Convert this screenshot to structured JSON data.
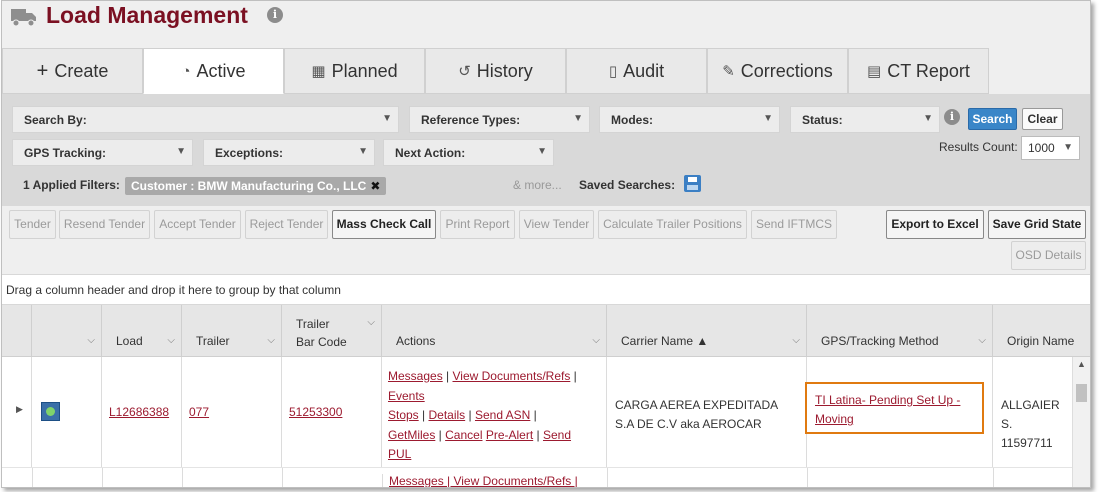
{
  "header": {
    "title": "Load Management",
    "info_icon": "info-icon"
  },
  "tabs": [
    {
      "label": "Create",
      "icon": "+"
    },
    {
      "label": "Active",
      "icon": "◔"
    },
    {
      "label": "Planned",
      "icon": "▦"
    },
    {
      "label": "History",
      "icon": "↺"
    },
    {
      "label": "Audit",
      "icon": "📋"
    },
    {
      "label": "Corrections",
      "icon": "✎"
    },
    {
      "label": "CT Report",
      "icon": "▤"
    }
  ],
  "filters": {
    "search_by": "Search By:",
    "reference_types": "Reference Types:",
    "modes": "Modes:",
    "status": "Status:",
    "gps_tracking": "GPS Tracking:",
    "exceptions": "Exceptions:",
    "next_action": "Next Action:",
    "search_button": "Search",
    "clear_button": "Clear",
    "results_count_label": "Results Count:",
    "results_count_value": "1000",
    "applied_filters": "1 Applied Filters:",
    "filter_chip": "Customer : BMW Manufacturing Co., LLC",
    "more": "& more...",
    "saved_searches": "Saved Searches:"
  },
  "toolbar": {
    "tender": "Tender",
    "resend_tender": "Resend Tender",
    "accept_tender": "Accept Tender",
    "reject_tender": "Reject Tender",
    "mass_check_call": "Mass Check Call",
    "print_report": "Print Report",
    "view_tender": "View Tender",
    "calc_trailer": "Calculate Trailer Positions",
    "send_iftmcs": "Send IFTMCS",
    "export_excel": "Export to Excel",
    "save_grid": "Save Grid State",
    "osd_details": "OSD Details"
  },
  "group_bar": "Drag a column header and drop it here to group by that column",
  "columns": {
    "load": "Load",
    "trailer": "Trailer",
    "trailer_bar_code_1": "Trailer",
    "trailer_bar_code_2": "Bar Code",
    "actions": "Actions",
    "carrier_name": "Carrier Name ▲",
    "gps": "GPS/Tracking Method",
    "origin": "Origin Name"
  },
  "row": {
    "load": "L12686388",
    "trailer": "077",
    "bar_code": "51253300",
    "actions": {
      "messages": "Messages",
      "view_docs": "View Documents/Refs",
      "events": "Events",
      "stops": "Stops",
      "details": "Details",
      "send_asn": "Send ASN",
      "getmiles": "GetMiles",
      "cancel": "Cancel",
      "pre_alert": "Pre-Alert",
      "send": "Send",
      "pul": "PUL"
    },
    "carrier_1": "CARGA AEREA EXPEDITADA",
    "carrier_2": "S.A DE C.V aka AEROCAR",
    "gps_1": "TI Latina- Pending Set Up -",
    "gps_2": "Moving",
    "origin_1": "ALLGAIER S.",
    "origin_2": "11597711"
  },
  "row2_partial": "Messages | View Documents/Refs |"
}
